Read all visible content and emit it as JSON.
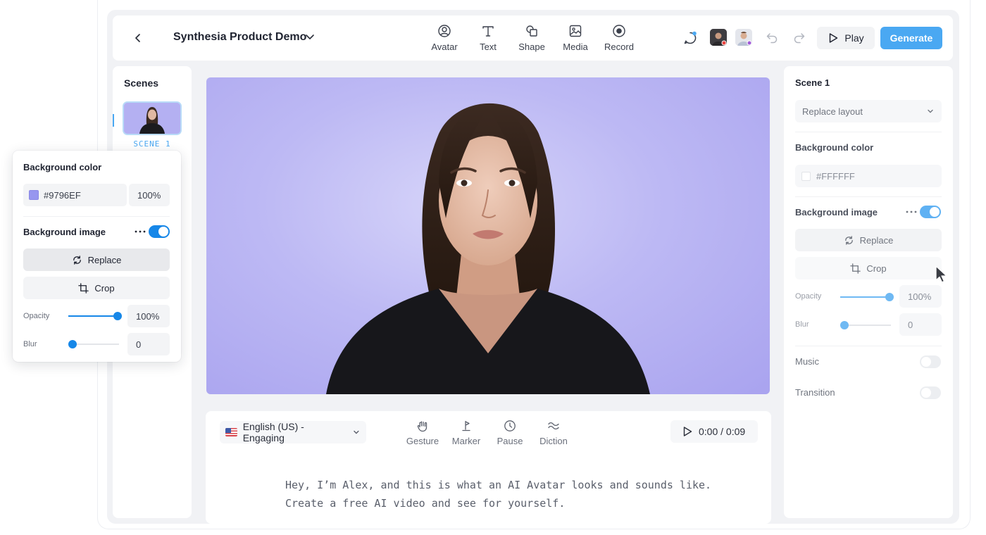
{
  "header": {
    "title": "Synthesia Product Demo",
    "tools": [
      {
        "label": "Avatar",
        "icon": "avatar-icon"
      },
      {
        "label": "Text",
        "icon": "text-icon"
      },
      {
        "label": "Shape",
        "icon": "shape-icon"
      },
      {
        "label": "Media",
        "icon": "media-icon"
      },
      {
        "label": "Record",
        "icon": "record-icon"
      }
    ],
    "play_label": "Play",
    "generate_label": "Generate",
    "accent_color": "#4aa8f2"
  },
  "scenes": {
    "title": "Scenes",
    "items": [
      {
        "label": "SCENE 1"
      }
    ]
  },
  "script": {
    "voice": "English (US) - Engaging",
    "tools": [
      {
        "label": "Gesture",
        "icon": "gesture-icon"
      },
      {
        "label": "Marker",
        "icon": "marker-icon"
      },
      {
        "label": "Pause",
        "icon": "pause-icon"
      },
      {
        "label": "Diction",
        "icon": "diction-icon"
      }
    ],
    "time": "0:00 / 0:09",
    "lines": [
      "Hey, I’m Alex, and this is what an AI Avatar looks and sounds like.",
      "Create a free AI video and see for yourself."
    ]
  },
  "properties": {
    "scene_title": "Scene 1",
    "layout_select": "Replace layout",
    "bg_color_label": "Background color",
    "bg_color_value": "#FFFFFF",
    "bg_image_label": "Background image",
    "bg_image_enabled": true,
    "replace_label": "Replace",
    "crop_label": "Crop",
    "opacity_label": "Opacity",
    "opacity_value": "100%",
    "blur_label": "Blur",
    "blur_value": "0",
    "music_label": "Music",
    "music_enabled": false,
    "transition_label": "Transition",
    "transition_enabled": false
  },
  "popover": {
    "bg_color_label": "Background color",
    "bg_color_value": "#9796EF",
    "bg_color_swatch": "#9796EF",
    "bg_color_opacity": "100%",
    "bg_image_label": "Background image",
    "bg_image_enabled": true,
    "replace_label": "Replace",
    "crop_label": "Crop",
    "opacity_label": "Opacity",
    "opacity_value": "100%",
    "blur_label": "Blur",
    "blur_value": "0"
  }
}
